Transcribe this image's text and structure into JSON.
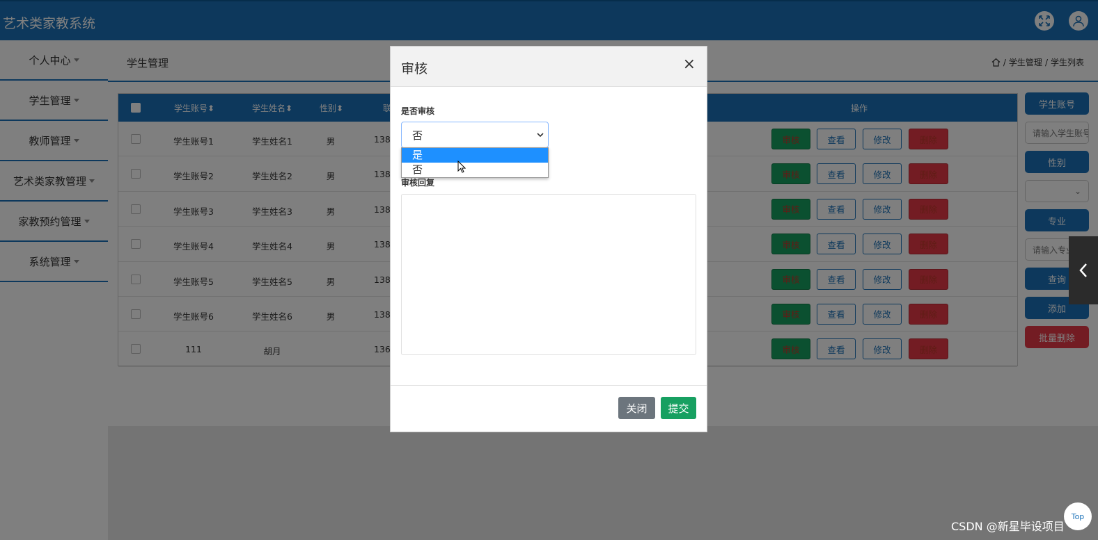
{
  "app": {
    "title": "艺术类家教系统"
  },
  "sidebar": {
    "items": [
      {
        "label": "个人中心"
      },
      {
        "label": "学生管理"
      },
      {
        "label": "教师管理"
      },
      {
        "label": "艺术类家教管理"
      },
      {
        "label": "家教预约管理"
      },
      {
        "label": "系统管理"
      }
    ]
  },
  "page": {
    "title": "学生管理",
    "breadcrumb": {
      "sep": "/",
      "level1": "学生管理",
      "level2": "学生列表"
    }
  },
  "table": {
    "headers": {
      "account": "学生账号",
      "name": "学生姓名",
      "gender": "性别",
      "contact": "联",
      "actions": "操作"
    },
    "buttons": {
      "audit": "审核",
      "view": "查看",
      "edit": "修改",
      "delete": "删除"
    },
    "rows": [
      {
        "account": "学生账号1",
        "name": "学生姓名1",
        "gender": "男",
        "phone": "138"
      },
      {
        "account": "学生账号2",
        "name": "学生姓名2",
        "gender": "男",
        "phone": "138"
      },
      {
        "account": "学生账号3",
        "name": "学生姓名3",
        "gender": "男",
        "phone": "138"
      },
      {
        "account": "学生账号4",
        "name": "学生姓名4",
        "gender": "男",
        "phone": "138"
      },
      {
        "account": "学生账号5",
        "name": "学生姓名5",
        "gender": "男",
        "phone": "138"
      },
      {
        "account": "学生账号6",
        "name": "学生姓名6",
        "gender": "男",
        "phone": "138"
      },
      {
        "account": "111",
        "name": "胡月",
        "gender": "",
        "phone": "136"
      }
    ]
  },
  "search_panel": {
    "account_label": "学生账号",
    "account_placeholder": "请输入学生账号",
    "gender_label": "性别",
    "major_label": "专业",
    "major_placeholder": "请输入专业",
    "query": "查询",
    "add": "添加",
    "batch_delete": "批量删除"
  },
  "modal": {
    "title": "审核",
    "close_x": "×",
    "field1_label": "是否审核",
    "select_value": "否",
    "options": [
      "是",
      "否"
    ],
    "highlighted_option": "是",
    "field2_label": "审核回复",
    "close_button": "关闭",
    "submit_button": "提交"
  },
  "overlay": {
    "top_button": "Top"
  },
  "watermark": "CSDN @新星毕设项目",
  "colors": {
    "primary": "#1a71b8",
    "success": "#17a061",
    "danger": "#e63946",
    "secondary": "#6c757d"
  }
}
